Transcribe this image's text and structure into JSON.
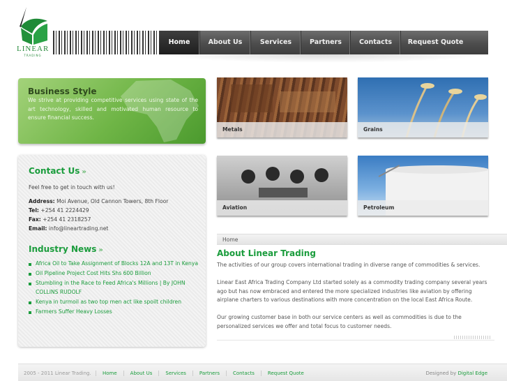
{
  "logo": {
    "name": "LINEAR",
    "sub": "TRADING"
  },
  "nav": [
    {
      "label": "Home",
      "active": true
    },
    {
      "label": "About Us",
      "active": false
    },
    {
      "label": "Services",
      "active": false
    },
    {
      "label": "Partners",
      "active": false
    },
    {
      "label": "Contacts",
      "active": false
    },
    {
      "label": "Request Quote",
      "active": false
    }
  ],
  "business": {
    "title": "Business Style",
    "text": "We strive at providing competitive services using state of the art technology, skilled and motivated human resource to ensure financial success."
  },
  "contact": {
    "title": "Contact Us",
    "intro": "Feel free to get in touch with us!",
    "address_label": "Address:",
    "address": "Moi Avenue, Old Cannon Towers, 8th Floor",
    "tel_label": "Tel:",
    "tel": "+254 41 2224429",
    "fax_label": "Fax:",
    "fax": "+254 41 2318257",
    "email_label": "Email:",
    "email": "info@lineartrading.net"
  },
  "news": {
    "title": "Industry News",
    "items": [
      "Africa Oil to Take Assignment of Blocks 12A and 13T in Kenya",
      "Oil Pipeline Project Cost Hits Shs 600 Billion",
      "Stumbling in the Race to Feed Africa's Millions | By JOHN COLLINS RUDOLF",
      "Kenya in turmoil as two top men act like spoilt children",
      "Farmers Suffer Heavy Losses"
    ]
  },
  "tiles": {
    "metals": "Metals",
    "grains": "Grains",
    "aviation": "Aviation",
    "petroleum": "Petroleum"
  },
  "breadcrumb": "Home",
  "about": {
    "title": "About Linear Trading",
    "p1": "The activities of our group covers international trading in diverse range of commodities & services.",
    "p2": "Linear East Africa Trading Company Ltd started solely as a commodity trading company several years ago but has now embraced and entered the more specialized industries like aviation by offering airplane charters to various destinations with more concentration on the local East Africa Route.",
    "p3": "Our growing customer base in both our service centers as well as commodities is due to the personalized services we offer and total focus to customer needs."
  },
  "footer": {
    "copyright": "2005 - 2011 Linear Trading.",
    "links": [
      "Home",
      "About Us",
      "Services",
      "Partners",
      "Contacts",
      "Request Quote"
    ],
    "designed_prefix": "Designed by",
    "designer": "Digital Edge"
  },
  "colors": {
    "green": "#1a9c3c",
    "nav": "#4d4d4d",
    "nav_active": "#1e1e1e"
  }
}
